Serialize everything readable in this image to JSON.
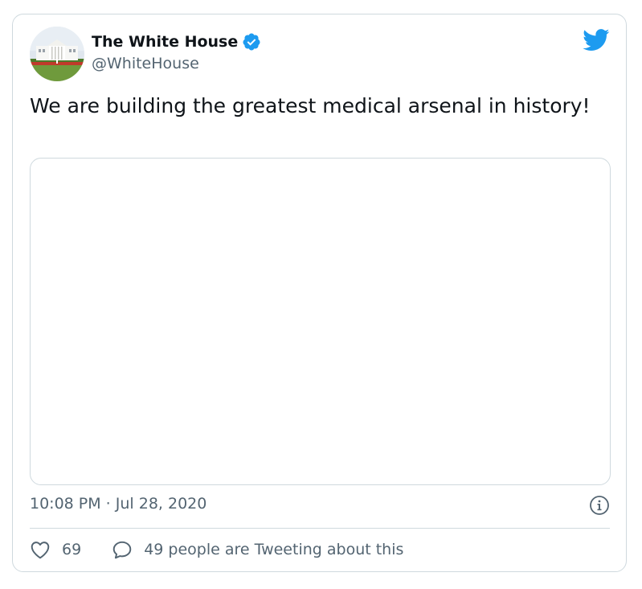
{
  "author": {
    "name": "The White House",
    "handle": "@WhiteHouse",
    "verified": true
  },
  "tweet": {
    "text": "We are building the greatest medical arsenal in history!"
  },
  "meta": {
    "timestamp": "10:08 PM · Jul 28, 2020"
  },
  "engagement": {
    "likes": "69",
    "replies_label": "49 people are Tweeting about this"
  },
  "icons": {
    "brand": "twitter-bird-icon",
    "verified": "verified-badge-icon",
    "info": "info-icon",
    "like": "heart-icon",
    "reply": "comment-bubble-icon"
  },
  "colors": {
    "twitter_blue": "#1d9bf0",
    "text_primary": "#0f1419",
    "text_secondary": "#536471",
    "border": "#cfd9de"
  }
}
